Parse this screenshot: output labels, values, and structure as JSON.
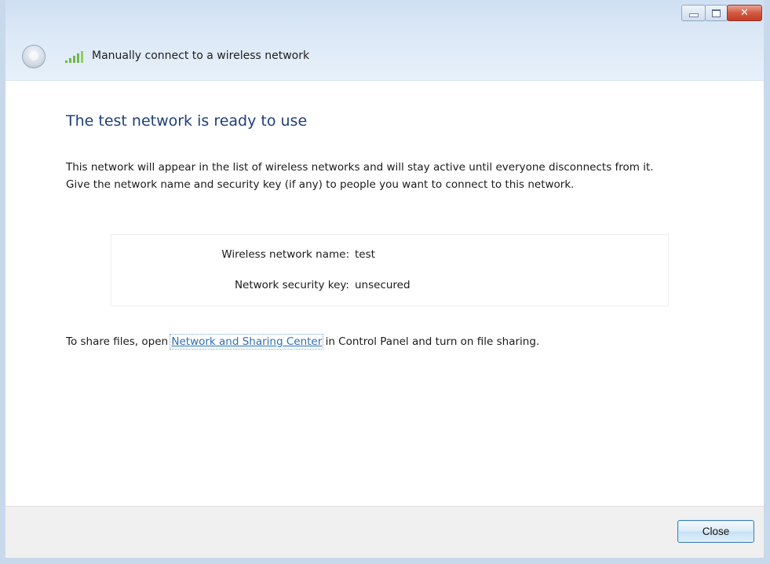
{
  "titlebar": {
    "title": "Manually connect to a wireless network",
    "caption_buttons": {
      "minimize_icon": "minimize-icon",
      "maximize_icon": "maximize-icon",
      "close_icon": "close-icon"
    }
  },
  "content": {
    "heading": "The test network is ready to use",
    "description": "This network will appear in the list of wireless networks and will stay active until everyone disconnects from it. Give the network name and security key (if any) to people you want to connect to this network.",
    "details": [
      {
        "label": "Wireless network name:",
        "value": "test"
      },
      {
        "label": "Network security key:",
        "value": "unsecured"
      }
    ],
    "share": {
      "prefix": "To share files, open ",
      "link_text": "Network and Sharing Center",
      "suffix": " in Control Panel and turn on file sharing."
    }
  },
  "footer": {
    "close_label": "Close"
  },
  "colors": {
    "heading": "#1f3f7b",
    "link": "#2f6fb3",
    "close_button_red": "#c23b22"
  }
}
